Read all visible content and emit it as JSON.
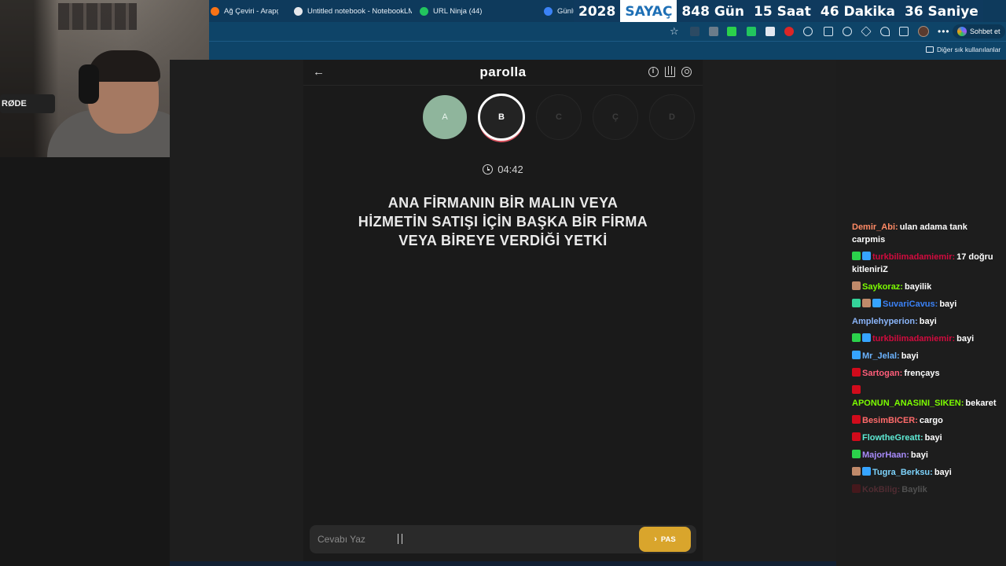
{
  "browser": {
    "tabs": [
      {
        "label": "Ağ Çeviri - Arapça - T",
        "color": "#f97316"
      },
      {
        "label": "Untitled notebook - NotebookLM",
        "color": "#e5e7eb"
      },
      {
        "label": "URL Ninja (44)",
        "color": "#22c55e"
      },
      {
        "label": "Günlü",
        "color": "#3b82f6"
      }
    ],
    "chat_button": "Sohbet et",
    "bookmark_folder": "Diğer sık kullanılanlar"
  },
  "countdown": {
    "year": "2028",
    "label": "SAYAÇ",
    "days": "848 Gün",
    "hours": "15 Saat",
    "minutes": "46 Dakika",
    "seconds": "36 Saniye"
  },
  "webcam": {
    "mic_brand": "RØDE"
  },
  "game": {
    "title": "parolla",
    "letters": [
      {
        "letter": "A",
        "state": "done"
      },
      {
        "letter": "B",
        "state": "active"
      },
      {
        "letter": "C",
        "state": "pending"
      },
      {
        "letter": "Ç",
        "state": "pending"
      },
      {
        "letter": "D",
        "state": "pending"
      }
    ],
    "timer": "04:42",
    "question": "ANA FİRMANIN BİR MALIN VEYA HİZMETİN SATIŞI İÇİN BAŞKA BİR FİRMA VEYA BİREYE VERDİĞİ YETKİ",
    "answer_placeholder": "Cevabı Yaz",
    "pass_label": "PAS"
  },
  "chat": {
    "messages": [
      {
        "user": "Demir_Abi",
        "user_color": "#ff8a65",
        "text": "ulan adama tank carpmis",
        "badges": []
      },
      {
        "user": "turkbilimadamiemir",
        "user_color": "#d10b3e",
        "text": "17 doğru kitleniriZ",
        "badges": [
          "#2bd14b",
          "#36a4ff"
        ]
      },
      {
        "user": "Saykoraz",
        "user_color": "#7cfc00",
        "text": "bayilik",
        "badges": [
          "#c08a6a"
        ]
      },
      {
        "user": "SuvariCavus",
        "user_color": "#3b82f6",
        "text": "bayi",
        "badges": [
          "#34d399",
          "#c08a6a",
          "#36a4ff"
        ]
      },
      {
        "user": "Amplehyperion",
        "user_color": "#8ab4f8",
        "text": "bayi",
        "badges": []
      },
      {
        "user": "turkbilimadamiemir",
        "user_color": "#d10b3e",
        "text": "bayi",
        "badges": [
          "#2bd14b",
          "#36a4ff"
        ]
      },
      {
        "user": "Mr_Jelal",
        "user_color": "#6bb3ff",
        "text": "bayi",
        "badges": [
          "#36a4ff"
        ]
      },
      {
        "user": "Sartogan",
        "user_color": "#ff5e7a",
        "text": "frençays",
        "badges": [
          "#d10b1b"
        ]
      },
      {
        "user": "APONUN_ANASINI_SIKEN",
        "user_color": "#7cfc00",
        "text": "bekaret",
        "badges": [
          "#d10b1b"
        ]
      },
      {
        "user": "BesimBICER",
        "user_color": "#ff6b6b",
        "text": "cargo",
        "badges": [
          "#d10b1b"
        ]
      },
      {
        "user": "FlowtheGreatt",
        "user_color": "#5eead4",
        "text": "bayi",
        "badges": [
          "#d10b1b"
        ]
      },
      {
        "user": "MajorHaan",
        "user_color": "#a78bfa",
        "text": "bayi",
        "badges": [
          "#2bd14b"
        ]
      },
      {
        "user": "Tugra_Berksu",
        "user_color": "#7dd3fc",
        "text": "bayi",
        "badges": [
          "#c08a6a",
          "#36a4ff"
        ]
      },
      {
        "user": "KokBilig",
        "user_color": "#ff5e7a",
        "text": "Baylik",
        "badges": [
          "#d10b1b"
        ],
        "faded": true
      }
    ]
  }
}
